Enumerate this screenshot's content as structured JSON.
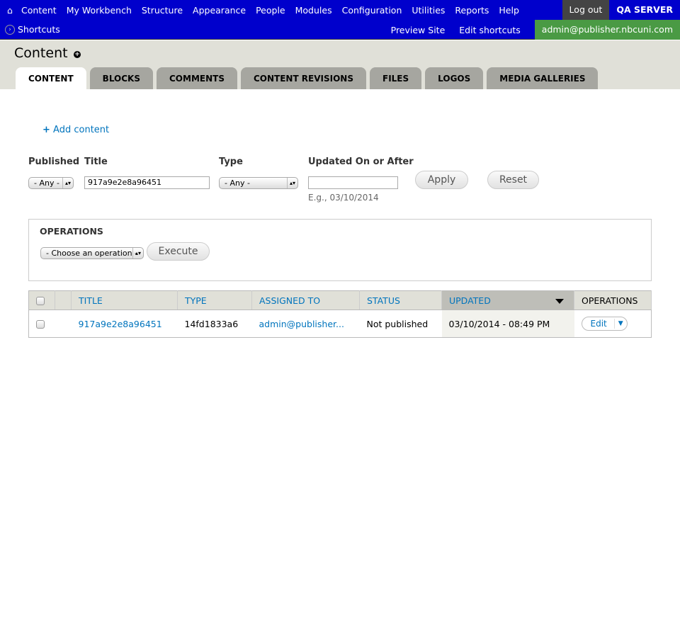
{
  "toolbar": {
    "menu": [
      "Content",
      "My Workbench",
      "Structure",
      "Appearance",
      "People",
      "Modules",
      "Configuration",
      "Utilities",
      "Reports",
      "Help"
    ],
    "logout": "Log out",
    "server": "QA SERVER"
  },
  "shortcuts": {
    "label": "Shortcuts",
    "preview": "Preview Site",
    "edit": "Edit shortcuts",
    "account": "admin@publisher.nbcuni.com"
  },
  "page": {
    "title": "Content",
    "tabs": [
      "CONTENT",
      "BLOCKS",
      "COMMENTS",
      "CONTENT REVISIONS",
      "FILES",
      "LOGOS",
      "MEDIA GALLERIES"
    ]
  },
  "add_content": "Add content",
  "filters": {
    "published_label": "Published",
    "published_value": "- Any -",
    "title_label": "Title",
    "title_value": "917a9e2e8a96451",
    "type_label": "Type",
    "type_value": "- Any -",
    "updated_label": "Updated On or After",
    "updated_value": "",
    "updated_hint": "E.g., 03/10/2014",
    "apply": "Apply",
    "reset": "Reset"
  },
  "operations": {
    "title": "OPERATIONS",
    "select": "- Choose an operation -",
    "execute": "Execute"
  },
  "table": {
    "headers": [
      "TITLE",
      "TYPE",
      "ASSIGNED TO",
      "STATUS",
      "UPDATED",
      "OPERATIONS"
    ],
    "rows": [
      {
        "title": "917a9e2e8a96451",
        "type": "14fd1833a6",
        "assigned": "admin@publisher...",
        "status": "Not published",
        "updated": "03/10/2014 - 08:49 PM",
        "edit": "Edit"
      }
    ]
  }
}
